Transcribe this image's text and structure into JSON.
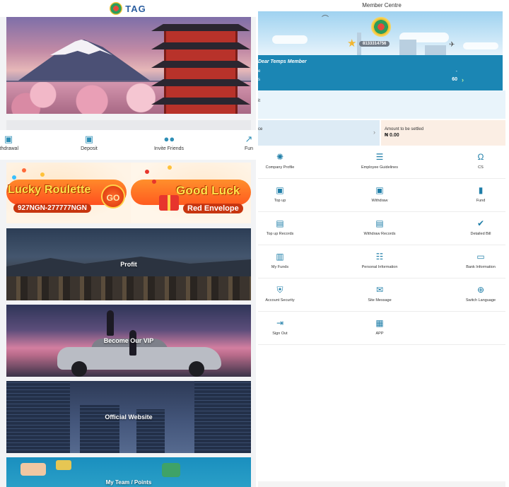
{
  "left": {
    "logo_text": "TAG",
    "quick_actions": [
      {
        "label": "ithdrawal",
        "icon": "wallet-icon"
      },
      {
        "label": "Deposit",
        "icon": "wallet-icon"
      },
      {
        "label": "Invite Friends",
        "icon": "users-icon"
      },
      {
        "label": "Fun",
        "icon": "chart-icon"
      }
    ],
    "promo_roulette": {
      "title": "Lucky Roulette",
      "sub": "927NGN-277777NGN",
      "button": "GO"
    },
    "promo_envelope": {
      "title": "Good Luck",
      "sub": "Red Envelope"
    },
    "tiles": [
      {
        "label": "Profit"
      },
      {
        "label": "Become Our VIP"
      },
      {
        "label": "Official Website"
      },
      {
        "label": "My Team / Points"
      }
    ]
  },
  "right": {
    "title": "Member Centre",
    "member_id": "8133314756",
    "greeting": "Dear Temps Member",
    "row1_label": "e",
    "row1_value": "-",
    "row2_label": "s",
    "row2_value": "60",
    "light_label": "it",
    "card1_label": "ce",
    "card2_label": "Amount to be settled",
    "card2_value": "₦ 0.00",
    "colors": {
      "accent": "#1b86b4",
      "icon": "#1f7ea8",
      "star": "#f2b632"
    },
    "grid": [
      [
        {
          "label": "Company Profile",
          "icon": "gear-icon"
        },
        {
          "label": "Employee Guidelines",
          "icon": "document-icon"
        },
        {
          "label": "CS",
          "icon": "headset-icon"
        }
      ],
      [
        {
          "label": "Top up",
          "icon": "wallet-icon"
        },
        {
          "label": "Withdraw",
          "icon": "wallet-icon"
        },
        {
          "label": "Fund",
          "icon": "bar-chart-icon"
        }
      ],
      [
        {
          "label": "Top up Records",
          "icon": "clipboard-icon"
        },
        {
          "label": "Withdraw Records",
          "icon": "clipboard-icon"
        },
        {
          "label": "Detailed Bill",
          "icon": "clipboard-check-icon"
        }
      ],
      [
        {
          "label": "My Funds",
          "icon": "fund-doc-icon"
        },
        {
          "label": "Personal Information",
          "icon": "person-card-icon"
        },
        {
          "label": "Bank Information",
          "icon": "card-icon"
        }
      ],
      [
        {
          "label": "Account Security",
          "icon": "shield-icon"
        },
        {
          "label": "Site Message",
          "icon": "envelope-icon"
        },
        {
          "label": "Switch Language",
          "icon": "globe-icon"
        }
      ],
      [
        {
          "label": "Sign Out",
          "icon": "sign-out-icon"
        },
        {
          "label": "APP",
          "icon": "grid-icon"
        }
      ]
    ]
  }
}
